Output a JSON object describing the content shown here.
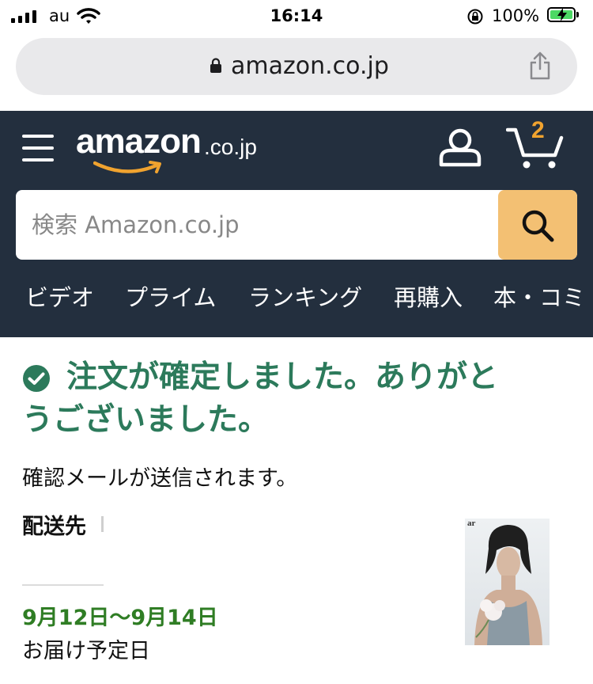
{
  "status_bar": {
    "carrier": "au",
    "time": "16:14",
    "battery": "100%"
  },
  "url_bar": {
    "domain": "amazon.co.jp"
  },
  "header": {
    "logo_word": "amazon",
    "logo_tld": ".co.jp",
    "cart_count": "2",
    "search_placeholder": "検索 Amazon.co.jp",
    "nav": [
      "ビデオ",
      "プライム",
      "ランキング",
      "再購入",
      "本・コミ"
    ]
  },
  "colors": {
    "header_bg": "#232f3e",
    "search_button": "#f3c073",
    "accent_orange": "#f0a32f",
    "success_green": "#2c7a5b",
    "date_green": "#2f7d24"
  },
  "confirmation": {
    "title_line1": "注文が確定しました。ありがと",
    "title_line2": "うございました。",
    "subtitle": "確認メールが送信されます。",
    "delivery_label": "配送先",
    "delivery_date": "9月12日〜9月14日",
    "delivery_date_label": "お届け予定日",
    "product_brand": "ar"
  }
}
